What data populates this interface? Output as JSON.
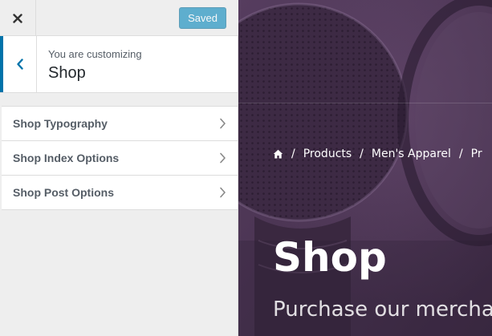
{
  "customizer": {
    "close_icon": "close-icon",
    "saved_label": "Saved",
    "back_icon": "chevron-left-icon",
    "customizing_label": "You are customizing",
    "section_title": "Shop",
    "accent_color": "#0073aa",
    "button_color": "#0085ba",
    "menu_items": [
      {
        "label": "Shop Typography",
        "icon": "chevron-right-icon"
      },
      {
        "label": "Shop Index Options",
        "icon": "chevron-right-icon"
      },
      {
        "label": "Shop Post Options",
        "icon": "chevron-right-icon"
      }
    ]
  },
  "preview": {
    "background_color": "#4a3452",
    "breadcrumb": {
      "home_icon": "home-icon",
      "separator": "/",
      "items": [
        "Products",
        "Men's Apparel",
        "Pr"
      ]
    },
    "hero_title": "Shop",
    "hero_subtitle": "Purchase our merchan"
  }
}
